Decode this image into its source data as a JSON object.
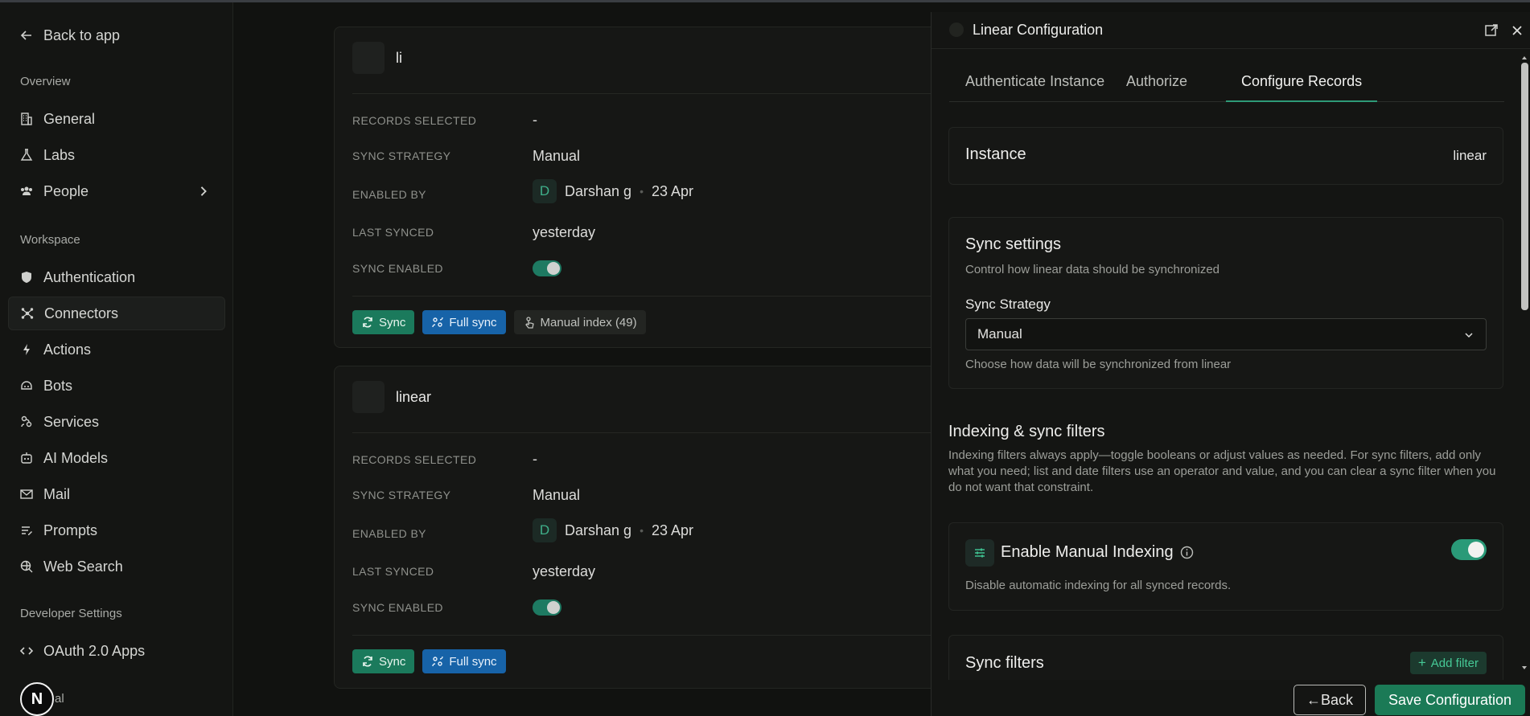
{
  "sidebar": {
    "back": "Back to app",
    "sections": {
      "overview": "Overview",
      "workspace": "Workspace",
      "developer": "Developer Settings",
      "cut": "al"
    },
    "items": {
      "general": "General",
      "labs": "Labs",
      "people": "People",
      "authentication": "Authentication",
      "connectors": "Connectors",
      "actions": "Actions",
      "bots": "Bots",
      "services": "Services",
      "ai_models": "AI Models",
      "mail": "Mail",
      "prompts": "Prompts",
      "web_search": "Web Search",
      "oauth": "OAuth 2.0 Apps"
    },
    "avatar_letter": "N"
  },
  "cards": [
    {
      "title": "li",
      "labels": {
        "records": "RECORDS SELECTED",
        "strategy": "SYNC STRATEGY",
        "enabled_by": "ENABLED BY",
        "last_synced": "LAST SYNCED",
        "sync_enabled": "SYNC ENABLED"
      },
      "records": "-",
      "strategy": "Manual",
      "user_initial": "D",
      "user": "Darshan g",
      "date": "23 Apr",
      "last_synced": "yesterday",
      "sync_label": "Sync",
      "full_sync_label": "Full sync",
      "manual_index_label": "Manual index (49)"
    },
    {
      "title": "linear",
      "labels": {
        "records": "RECORDS SELECTED",
        "strategy": "SYNC STRATEGY",
        "enabled_by": "ENABLED BY",
        "last_synced": "LAST SYNCED",
        "sync_enabled": "SYNC ENABLED"
      },
      "records": "-",
      "strategy": "Manual",
      "user_initial": "D",
      "user": "Darshan g",
      "date": "23 Apr",
      "last_synced": "yesterday",
      "sync_label": "Sync",
      "full_sync_label": "Full sync"
    }
  ],
  "panel": {
    "title": "Linear Configuration",
    "tabs": [
      "Authenticate Instance",
      "Authorize",
      "Configure Records"
    ],
    "instance_label": "Instance",
    "instance_value": "linear",
    "sync_settings": {
      "title": "Sync settings",
      "subtitle": "Control how linear data should be synchronized",
      "strategy_label": "Sync Strategy",
      "strategy_value": "Manual",
      "help": "Choose how data will be synchronized from linear"
    },
    "filters": {
      "title": "Indexing & sync filters",
      "description": "Indexing filters always apply—toggle booleans or adjust values as needed. For sync filters, add only what you need; list and date filters use an operator and value, and you can clear a sync filter when you do not want that constraint."
    },
    "manual_indexing": {
      "title": "Enable Manual Indexing",
      "description": "Disable automatic indexing for all synced records."
    },
    "sync_filters": {
      "title": "Sync filters",
      "add_label": "Add filter"
    },
    "back_label": "←Back",
    "save_label": "Save Configuration"
  }
}
